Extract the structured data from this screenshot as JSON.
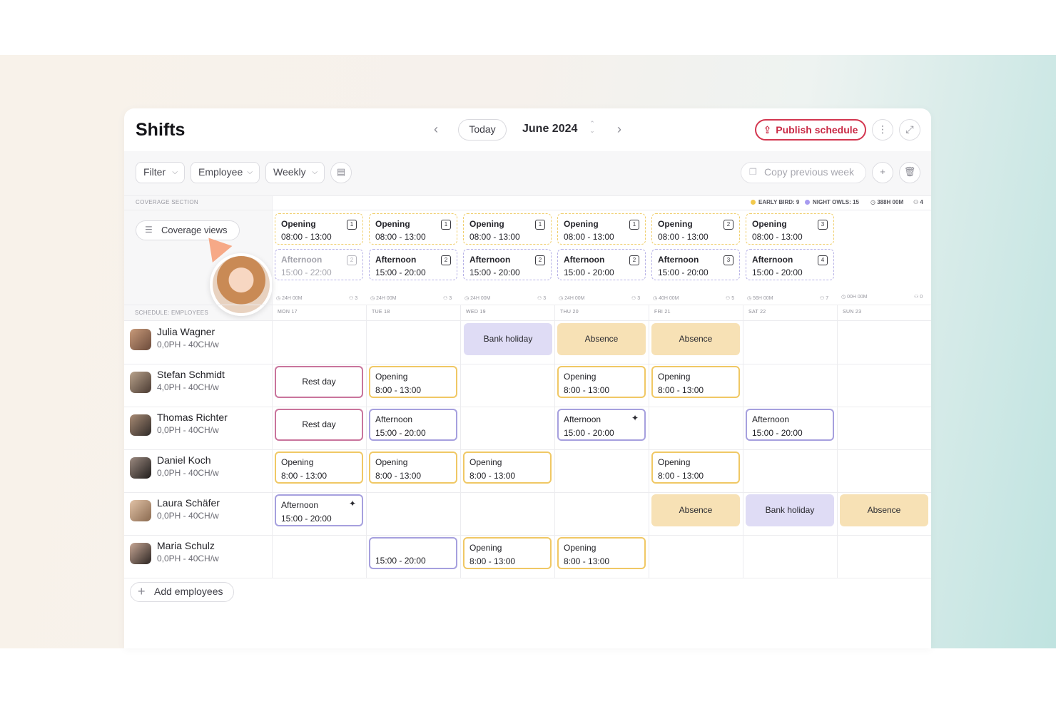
{
  "header": {
    "title": "Shifts",
    "today_label": "Today",
    "month_label": "June 2024",
    "publish_label": "Publish schedule"
  },
  "toolbar": {
    "filter_label": "Filter",
    "employee_label": "Employee",
    "weekly_label": "Weekly",
    "copy_label": "Copy previous week"
  },
  "coverage": {
    "section_label": "COVERAGE SECTION",
    "views_label": "Coverage views",
    "legend": {
      "early_bird": "EARLY BIRD: 9",
      "night_owls": "NIGHT OWLS: 15",
      "total_hours": "388H 00M",
      "total_people": "4"
    },
    "days": [
      {
        "opening": {
          "name": "Opening",
          "time": "08:00 - 13:00",
          "count": "1"
        },
        "afternoon": {
          "name": "Afternoon",
          "time": "15:00 - 22:00",
          "count": "2"
        },
        "hours": "24H 00M",
        "people": "3"
      },
      {
        "opening": {
          "name": "Opening",
          "time": "08:00 - 13:00",
          "count": "1"
        },
        "afternoon": {
          "name": "Afternoon",
          "time": "15:00 - 20:00",
          "count": "2"
        },
        "hours": "24H 00M",
        "people": "3"
      },
      {
        "opening": {
          "name": "Opening",
          "time": "08:00 - 13:00",
          "count": "1"
        },
        "afternoon": {
          "name": "Afternoon",
          "time": "15:00 - 20:00",
          "count": "2"
        },
        "hours": "24H 00M",
        "people": "3"
      },
      {
        "opening": {
          "name": "Opening",
          "time": "08:00 - 13:00",
          "count": "1"
        },
        "afternoon": {
          "name": "Afternoon",
          "time": "15:00 - 20:00",
          "count": "2"
        },
        "hours": "24H 00M",
        "people": "3"
      },
      {
        "opening": {
          "name": "Opening",
          "time": "08:00 - 13:00",
          "count": "2"
        },
        "afternoon": {
          "name": "Afternoon",
          "time": "15:00 - 20:00",
          "count": "3"
        },
        "hours": "40H 00M",
        "people": "5"
      },
      {
        "opening": {
          "name": "Opening",
          "time": "08:00 - 13:00",
          "count": "3"
        },
        "afternoon": {
          "name": "Afternoon",
          "time": "15:00 - 20:00",
          "count": "4"
        },
        "hours": "56H 00M",
        "people": "7"
      },
      {
        "hours": "00H 00M",
        "people": "0"
      }
    ]
  },
  "schedule": {
    "section_label": "SCHEDULE: EMPLOYEES",
    "day_headers": [
      "MON 17",
      "TUE 18",
      "WED 19",
      "THU 20",
      "FRI 21",
      "SAT 22",
      "SUN 23"
    ],
    "employees": [
      {
        "name": "Julia Wagner",
        "hours": "0,0PH - 40CH/w"
      },
      {
        "name": "Stefan Schmidt",
        "hours": "4,0PH - 40CH/w"
      },
      {
        "name": "Thomas Richter",
        "hours": "0,0PH - 40CH/w"
      },
      {
        "name": "Daniel Koch",
        "hours": "0,0PH - 40CH/w"
      },
      {
        "name": "Laura Schäfer",
        "hours": "0,0PH - 40CH/w"
      },
      {
        "name": "Maria Schulz",
        "hours": "0,0PH - 40CH/w"
      }
    ],
    "labels": {
      "bank_holiday": "Bank holiday",
      "absence": "Absence",
      "rest_day": "Rest day",
      "opening": "Opening",
      "afternoon": "Afternoon",
      "opening_time": "8:00 - 13:00",
      "afternoon_time": "15:00 - 20:00"
    },
    "add_employees_label": "Add employees"
  },
  "colors": {
    "accent_red": "#d3364f",
    "opening_yellow": "#f0c865",
    "afternoon_purple": "#a6a0de",
    "rest_pink": "#c9749c",
    "absence_fill": "#f7e1b5",
    "bank_holiday_fill": "#dfdcf5"
  }
}
